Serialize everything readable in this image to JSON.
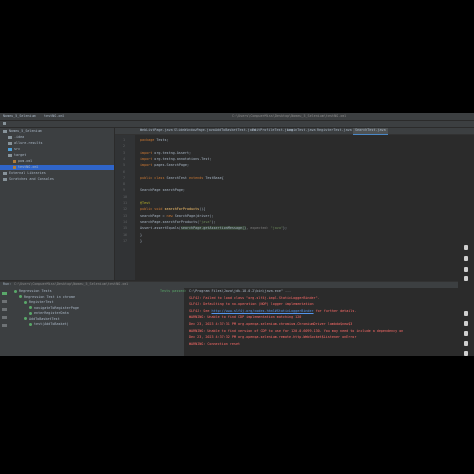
{
  "window": {
    "project_tab": "Nomeu_5_Selenium",
    "file_tab": "testNG.xml",
    "path": "C:\\Users\\CompuerMiss\\Desktop\\Nomeu_5_Selenium\\testNG.xml"
  },
  "project_tree": [
    {
      "label": "Nomeu_5_Selenium",
      "kind": "folder"
    },
    {
      "label": ".idea",
      "kind": "folder"
    },
    {
      "label": "allure-results",
      "kind": "folder"
    },
    {
      "label": "src",
      "kind": "src"
    },
    {
      "label": "target",
      "kind": "folder"
    },
    {
      "label": "pom.xml",
      "kind": "file"
    },
    {
      "label": "testNG.xml",
      "kind": "file",
      "selected": true
    },
    {
      "label": "External Libraries",
      "kind": "folder"
    },
    {
      "label": "Scratches and Consoles",
      "kind": "folder"
    }
  ],
  "editor_tabs": [
    {
      "label": "WebListPage.java"
    },
    {
      "label": "SlideWindowPage.java"
    },
    {
      "label": "AddToBasketTest.java"
    },
    {
      "label": "EditProfileTest.java"
    },
    {
      "label": "LoginTest.java"
    },
    {
      "label": "RegisterTest.java"
    },
    {
      "label": "SearchTest.java",
      "active": true
    }
  ],
  "code_lines": [
    {
      "n": "1",
      "html": "<span class='kw'>package</span> Tests;"
    },
    {
      "n": "2",
      "html": ""
    },
    {
      "n": "3",
      "html": "<span class='kw'>import</span> org.testng.Assert;"
    },
    {
      "n": "4",
      "html": "<span class='kw'>import</span> org.testng.annotations.Test;"
    },
    {
      "n": "5",
      "html": "<span class='kw'>import</span> pages.SearchPage;"
    },
    {
      "n": "6",
      "html": ""
    },
    {
      "n": "7",
      "html": "<span class='kw'>public class</span> SearchTest <span class='kw'>extends</span> TestBase{"
    },
    {
      "n": "8",
      "html": ""
    },
    {
      "n": "9",
      "html": "    SearchPage searchPage;"
    },
    {
      "n": "10",
      "html": ""
    },
    {
      "n": "11",
      "html": "    <span class='an'>@Test</span>"
    },
    {
      "n": "12",
      "html": "    <span class='kw'>public void</span> <span class='fn'>searchForProducts</span>(){"
    },
    {
      "n": "13",
      "html": "        searchPage = <span class='kw'>new</span> SearchPage(driver);"
    },
    {
      "n": "14",
      "html": "        searchPage.searchForProducts(<span class='str'>\"java\"</span>);"
    },
    {
      "n": "15",
      "html": "        Assert.assertEquals(<span class='hl'>searchPage.getAssertionMessage()</span>, <span class='dim'>expected:</span> <span class='str'>\"java\"</span>);"
    },
    {
      "n": "16",
      "html": "    }"
    },
    {
      "n": "17",
      "html": "}"
    }
  ],
  "run_bar": {
    "label": "Run:",
    "config": "C:\\Users\\CompuerMiss\\Desktop\\Nomeu_5_Selenium\\testNG.xml"
  },
  "run_tree": [
    {
      "label": "Regression Tests",
      "indent": 0
    },
    {
      "label": "Regression Test in chrome",
      "indent": 1
    },
    {
      "label": "RegisterTest",
      "indent": 2
    },
    {
      "label": "navigateToRegisterPage",
      "indent": 3
    },
    {
      "label": "enterRegisterData",
      "indent": 3
    },
    {
      "label": "AddToBasketTest",
      "indent": 2
    },
    {
      "label": "test(AddToBasket)",
      "indent": 3
    }
  ],
  "run_status": "Tests passed: 4",
  "console_lines": [
    {
      "html": "C:\\Program Files\\Java\\jdk-18.0.2\\bin\\java.exe\" ..."
    },
    {
      "html": "<span class='err'>SLF4J: Failed to load class \"org.slf4j.impl.StaticLoggerBinder\".</span>"
    },
    {
      "html": "<span class='err'>SLF4J: Defaulting to no-operation (NOP) logger implementation</span>"
    },
    {
      "html": "<span class='err'>SLF4J: See </span><span class='url'>http://www.slf4j.org/codes.html#StaticLoggerBinder</span><span class='err'> for further details.</span>"
    },
    {
      "html": "<span class='err'>WARNING: Unable to find CDP implementation matching 120</span>"
    },
    {
      "html": "<span class='err'>Dec 23, 2023 4:37:31 PM org.openqa.selenium.chromium.ChromiumDriver lambda$new$3</span>"
    },
    {
      "html": "<span class='err'>WARNING: Unable to find version of CDP to use for 120.0.6099.130. You may need to include a dependency on</span>"
    },
    {
      "html": "<span class='err'>Dec 23, 2023 4:37:32 PM org.openqa.selenium.remote.http.WebSocket$Listener onError</span>"
    },
    {
      "html": "<span class='err'>WARNING: Connection reset</span>"
    }
  ],
  "colors": {
    "accent": "#2f65ca",
    "keyword": "#cc7832",
    "string": "#6a8759",
    "error": "#ff6b68",
    "passed": "#59a869"
  }
}
